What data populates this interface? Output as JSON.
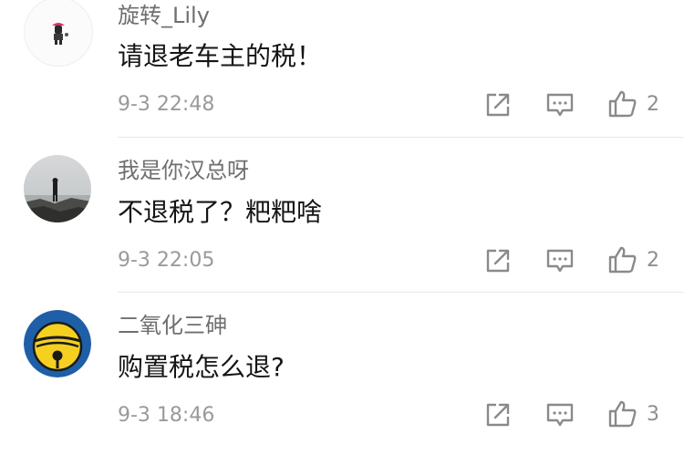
{
  "comments": [
    {
      "username": "旋转_Lily",
      "content": "请退老车主的税！",
      "time": "9-3 22:48",
      "likes": "2",
      "avatar_icon": "cartoon-character-avatar"
    },
    {
      "username": "我是你汉总呀",
      "content": "不退税了？粑粑啥",
      "time": "9-3 22:05",
      "likes": "2",
      "avatar_icon": "person-seaside-photo-avatar"
    },
    {
      "username": "二氧化三砷",
      "content": "购置税怎么退?",
      "time": "9-3 18:46",
      "likes": "3",
      "avatar_icon": "yellow-bell-avatar"
    }
  ],
  "icons": {
    "share": "share-icon",
    "comment": "comment-icon",
    "like": "thumbs-up-icon"
  },
  "colors": {
    "username": "#6f6f6f",
    "content": "#151515",
    "time": "#9a9a9a",
    "icon": "#8a8a8a",
    "bell_yellow": "#f5d020",
    "bell_blue": "#1e5fa8"
  }
}
